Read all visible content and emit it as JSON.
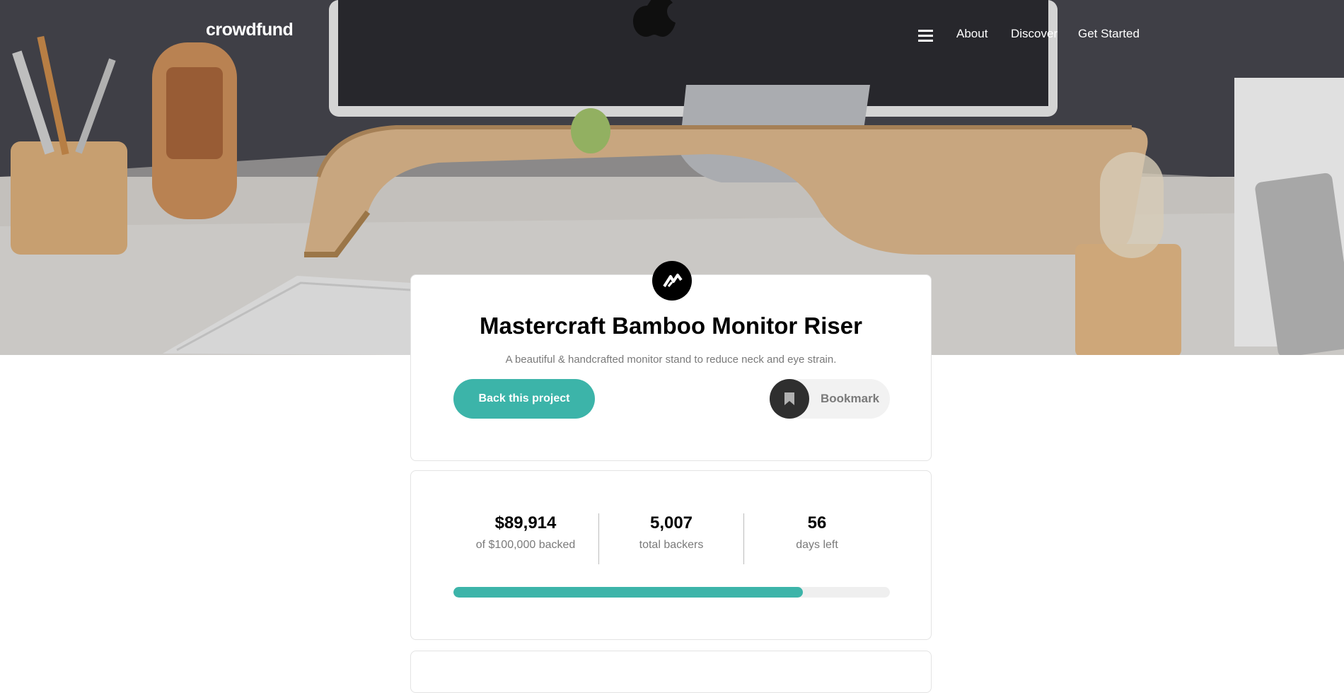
{
  "nav": {
    "logo": "crowdfund",
    "links": [
      "About",
      "Discover",
      "Get Started"
    ],
    "menu_icon": "hamburger-icon"
  },
  "project": {
    "logo_icon": "mastercraft-logo-icon",
    "title": "Mastercraft Bamboo Monitor Riser",
    "description": "A beautiful & handcrafted monitor stand to reduce neck and eye strain.",
    "back_label": "Back this project",
    "bookmark_label": "Bookmark",
    "bookmark_icon": "bookmark-icon"
  },
  "stats": [
    {
      "value": "$89,914",
      "label": "of $100,000 backed"
    },
    {
      "value": "5,007",
      "label": "total backers"
    },
    {
      "value": "56",
      "label": "days left"
    }
  ],
  "progress": {
    "fraction": 0.8
  },
  "colors": {
    "accent": "#3cb4a9",
    "dark": "#2f2f2f",
    "muted": "#7a7a7a"
  }
}
